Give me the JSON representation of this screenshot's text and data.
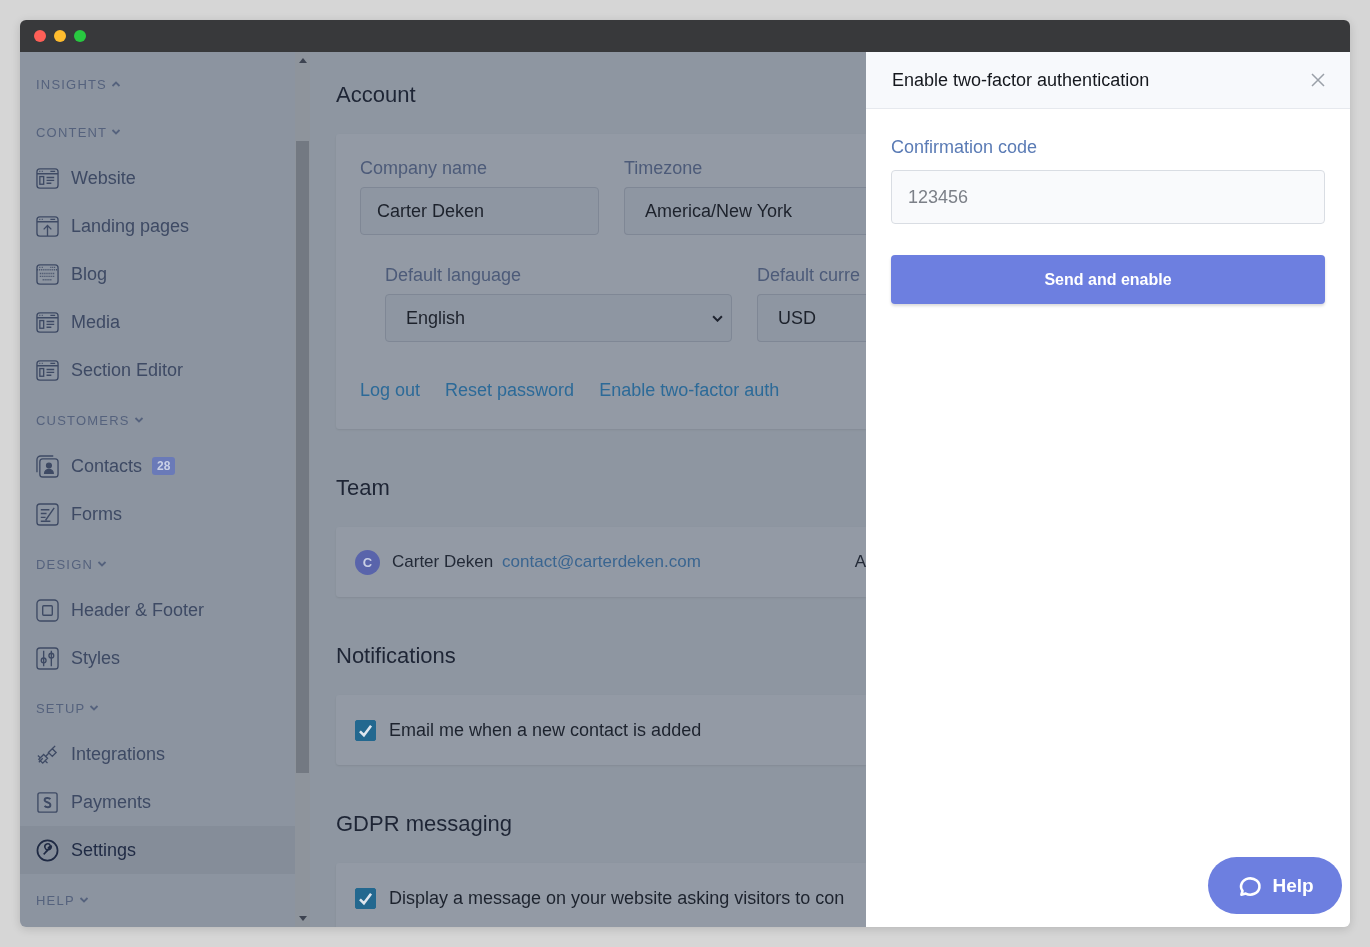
{
  "sidebar": {
    "sections": [
      {
        "title": "INSIGHTS",
        "expanded": false
      },
      {
        "title": "CONTENT",
        "expanded": true,
        "items": [
          {
            "label": "Website",
            "kind": "browser",
            "selected": false
          },
          {
            "label": "Landing pages",
            "kind": "upload",
            "selected": false
          },
          {
            "label": "Blog",
            "kind": "keyboard",
            "selected": false
          },
          {
            "label": "Media",
            "kind": "browser",
            "selected": false
          },
          {
            "label": "Section Editor",
            "kind": "browser",
            "selected": false
          }
        ]
      },
      {
        "title": "CUSTOMERS",
        "expanded": true,
        "items": [
          {
            "label": "Contacts",
            "kind": "contact",
            "selected": false,
            "badge": "28"
          },
          {
            "label": "Forms",
            "kind": "form",
            "selected": false
          }
        ]
      },
      {
        "title": "DESIGN",
        "expanded": true,
        "items": [
          {
            "label": "Header & Footer",
            "kind": "square",
            "selected": false
          },
          {
            "label": "Styles",
            "kind": "sliders",
            "selected": false
          }
        ]
      },
      {
        "title": "SETUP",
        "expanded": true,
        "items": [
          {
            "label": "Integrations",
            "kind": "plug",
            "selected": false
          },
          {
            "label": "Payments",
            "kind": "dollar",
            "selected": false
          },
          {
            "label": "Settings",
            "kind": "gear",
            "selected": true
          }
        ]
      },
      {
        "title": "HELP",
        "expanded": true
      }
    ]
  },
  "account": {
    "heading": "Account",
    "company": {
      "label": "Company name",
      "value": "Carter Deken"
    },
    "timezone": {
      "label": "Timezone",
      "value": "America/New York"
    },
    "language": {
      "label": "Default language",
      "value": "English"
    },
    "currency": {
      "label": "Default curre",
      "value": "USD"
    },
    "links": [
      "Log out",
      "Reset password",
      "Enable two-factor auth"
    ]
  },
  "team": {
    "heading": "Team",
    "members": [
      {
        "initial": "C",
        "name": "Carter Deken",
        "email": "contact@carterdeken.com",
        "column_3": "A"
      }
    ]
  },
  "notifications": {
    "heading": "Notifications",
    "options": [
      {
        "label": "Email me when a new contact is added",
        "checked": true
      }
    ]
  },
  "gdpr": {
    "heading": "GDPR messaging",
    "options": [
      {
        "label": "Display a message on your website asking visitors to con",
        "checked": true
      }
    ]
  },
  "modal": {
    "title": "Enable two-factor authentication",
    "field_label": "Confirmation code",
    "placeholder": "123456",
    "button": "Send and enable"
  },
  "help_button": "Help"
}
